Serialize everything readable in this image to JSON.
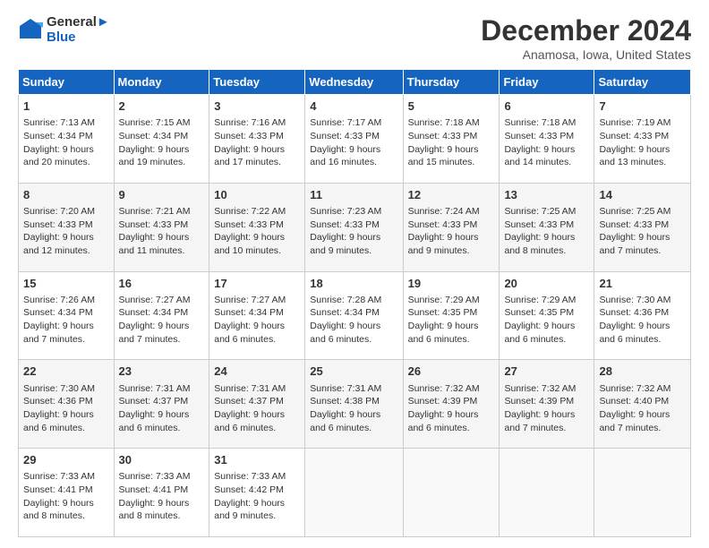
{
  "header": {
    "logo_line1": "General",
    "logo_line2": "Blue",
    "month": "December 2024",
    "location": "Anamosa, Iowa, United States"
  },
  "days_of_week": [
    "Sunday",
    "Monday",
    "Tuesday",
    "Wednesday",
    "Thursday",
    "Friday",
    "Saturday"
  ],
  "weeks": [
    [
      {
        "day": "1",
        "sunrise": "7:13 AM",
        "sunset": "4:34 PM",
        "daylight_h": "9",
        "daylight_m": "20"
      },
      {
        "day": "2",
        "sunrise": "7:15 AM",
        "sunset": "4:34 PM",
        "daylight_h": "9",
        "daylight_m": "19"
      },
      {
        "day": "3",
        "sunrise": "7:16 AM",
        "sunset": "4:33 PM",
        "daylight_h": "9",
        "daylight_m": "17"
      },
      {
        "day": "4",
        "sunrise": "7:17 AM",
        "sunset": "4:33 PM",
        "daylight_h": "9",
        "daylight_m": "16"
      },
      {
        "day": "5",
        "sunrise": "7:18 AM",
        "sunset": "4:33 PM",
        "daylight_h": "9",
        "daylight_m": "15"
      },
      {
        "day": "6",
        "sunrise": "7:18 AM",
        "sunset": "4:33 PM",
        "daylight_h": "9",
        "daylight_m": "14"
      },
      {
        "day": "7",
        "sunrise": "7:19 AM",
        "sunset": "4:33 PM",
        "daylight_h": "9",
        "daylight_m": "13"
      }
    ],
    [
      {
        "day": "8",
        "sunrise": "7:20 AM",
        "sunset": "4:33 PM",
        "daylight_h": "9",
        "daylight_m": "12"
      },
      {
        "day": "9",
        "sunrise": "7:21 AM",
        "sunset": "4:33 PM",
        "daylight_h": "9",
        "daylight_m": "11"
      },
      {
        "day": "10",
        "sunrise": "7:22 AM",
        "sunset": "4:33 PM",
        "daylight_h": "9",
        "daylight_m": "10"
      },
      {
        "day": "11",
        "sunrise": "7:23 AM",
        "sunset": "4:33 PM",
        "daylight_h": "9",
        "daylight_m": "9"
      },
      {
        "day": "12",
        "sunrise": "7:24 AM",
        "sunset": "4:33 PM",
        "daylight_h": "9",
        "daylight_m": "9"
      },
      {
        "day": "13",
        "sunrise": "7:25 AM",
        "sunset": "4:33 PM",
        "daylight_h": "9",
        "daylight_m": "8"
      },
      {
        "day": "14",
        "sunrise": "7:25 AM",
        "sunset": "4:33 PM",
        "daylight_h": "9",
        "daylight_m": "7"
      }
    ],
    [
      {
        "day": "15",
        "sunrise": "7:26 AM",
        "sunset": "4:34 PM",
        "daylight_h": "9",
        "daylight_m": "7"
      },
      {
        "day": "16",
        "sunrise": "7:27 AM",
        "sunset": "4:34 PM",
        "daylight_h": "9",
        "daylight_m": "7"
      },
      {
        "day": "17",
        "sunrise": "7:27 AM",
        "sunset": "4:34 PM",
        "daylight_h": "9",
        "daylight_m": "6"
      },
      {
        "day": "18",
        "sunrise": "7:28 AM",
        "sunset": "4:34 PM",
        "daylight_h": "9",
        "daylight_m": "6"
      },
      {
        "day": "19",
        "sunrise": "7:29 AM",
        "sunset": "4:35 PM",
        "daylight_h": "9",
        "daylight_m": "6"
      },
      {
        "day": "20",
        "sunrise": "7:29 AM",
        "sunset": "4:35 PM",
        "daylight_h": "9",
        "daylight_m": "6"
      },
      {
        "day": "21",
        "sunrise": "7:30 AM",
        "sunset": "4:36 PM",
        "daylight_h": "9",
        "daylight_m": "6"
      }
    ],
    [
      {
        "day": "22",
        "sunrise": "7:30 AM",
        "sunset": "4:36 PM",
        "daylight_h": "9",
        "daylight_m": "6"
      },
      {
        "day": "23",
        "sunrise": "7:31 AM",
        "sunset": "4:37 PM",
        "daylight_h": "9",
        "daylight_m": "6"
      },
      {
        "day": "24",
        "sunrise": "7:31 AM",
        "sunset": "4:37 PM",
        "daylight_h": "9",
        "daylight_m": "6"
      },
      {
        "day": "25",
        "sunrise": "7:31 AM",
        "sunset": "4:38 PM",
        "daylight_h": "9",
        "daylight_m": "6"
      },
      {
        "day": "26",
        "sunrise": "7:32 AM",
        "sunset": "4:39 PM",
        "daylight_h": "9",
        "daylight_m": "6"
      },
      {
        "day": "27",
        "sunrise": "7:32 AM",
        "sunset": "4:39 PM",
        "daylight_h": "9",
        "daylight_m": "7"
      },
      {
        "day": "28",
        "sunrise": "7:32 AM",
        "sunset": "4:40 PM",
        "daylight_h": "9",
        "daylight_m": "7"
      }
    ],
    [
      {
        "day": "29",
        "sunrise": "7:33 AM",
        "sunset": "4:41 PM",
        "daylight_h": "9",
        "daylight_m": "8"
      },
      {
        "day": "30",
        "sunrise": "7:33 AM",
        "sunset": "4:41 PM",
        "daylight_h": "9",
        "daylight_m": "8"
      },
      {
        "day": "31",
        "sunrise": "7:33 AM",
        "sunset": "4:42 PM",
        "daylight_h": "9",
        "daylight_m": "9"
      },
      null,
      null,
      null,
      null
    ]
  ]
}
